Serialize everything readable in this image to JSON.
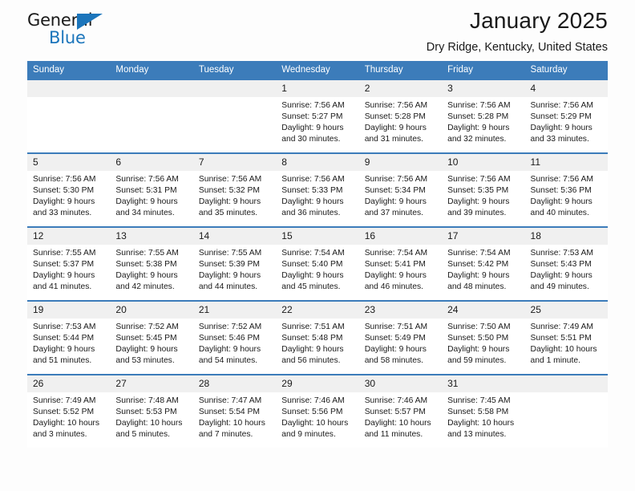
{
  "brand": {
    "name_top": "General",
    "name_bottom": "Blue",
    "flag_icon": "triangle-flag-icon",
    "accent_color": "#1b75bb"
  },
  "header": {
    "title": "January 2025",
    "location": "Dry Ridge, Kentucky, United States"
  },
  "calendar": {
    "header_bg": "#3c7cba",
    "daynum_bg": "#f0f0f0",
    "weekdays": [
      "Sunday",
      "Monday",
      "Tuesday",
      "Wednesday",
      "Thursday",
      "Friday",
      "Saturday"
    ],
    "weeks": [
      [
        {
          "day": "",
          "empty": true,
          "lines": []
        },
        {
          "day": "",
          "empty": true,
          "lines": []
        },
        {
          "day": "",
          "empty": true,
          "lines": []
        },
        {
          "day": "1",
          "lines": [
            "Sunrise: 7:56 AM",
            "Sunset: 5:27 PM",
            "Daylight: 9 hours",
            "and 30 minutes."
          ]
        },
        {
          "day": "2",
          "lines": [
            "Sunrise: 7:56 AM",
            "Sunset: 5:28 PM",
            "Daylight: 9 hours",
            "and 31 minutes."
          ]
        },
        {
          "day": "3",
          "lines": [
            "Sunrise: 7:56 AM",
            "Sunset: 5:28 PM",
            "Daylight: 9 hours",
            "and 32 minutes."
          ]
        },
        {
          "day": "4",
          "lines": [
            "Sunrise: 7:56 AM",
            "Sunset: 5:29 PM",
            "Daylight: 9 hours",
            "and 33 minutes."
          ]
        }
      ],
      [
        {
          "day": "5",
          "lines": [
            "Sunrise: 7:56 AM",
            "Sunset: 5:30 PM",
            "Daylight: 9 hours",
            "and 33 minutes."
          ]
        },
        {
          "day": "6",
          "lines": [
            "Sunrise: 7:56 AM",
            "Sunset: 5:31 PM",
            "Daylight: 9 hours",
            "and 34 minutes."
          ]
        },
        {
          "day": "7",
          "lines": [
            "Sunrise: 7:56 AM",
            "Sunset: 5:32 PM",
            "Daylight: 9 hours",
            "and 35 minutes."
          ]
        },
        {
          "day": "8",
          "lines": [
            "Sunrise: 7:56 AM",
            "Sunset: 5:33 PM",
            "Daylight: 9 hours",
            "and 36 minutes."
          ]
        },
        {
          "day": "9",
          "lines": [
            "Sunrise: 7:56 AM",
            "Sunset: 5:34 PM",
            "Daylight: 9 hours",
            "and 37 minutes."
          ]
        },
        {
          "day": "10",
          "lines": [
            "Sunrise: 7:56 AM",
            "Sunset: 5:35 PM",
            "Daylight: 9 hours",
            "and 39 minutes."
          ]
        },
        {
          "day": "11",
          "lines": [
            "Sunrise: 7:56 AM",
            "Sunset: 5:36 PM",
            "Daylight: 9 hours",
            "and 40 minutes."
          ]
        }
      ],
      [
        {
          "day": "12",
          "lines": [
            "Sunrise: 7:55 AM",
            "Sunset: 5:37 PM",
            "Daylight: 9 hours",
            "and 41 minutes."
          ]
        },
        {
          "day": "13",
          "lines": [
            "Sunrise: 7:55 AM",
            "Sunset: 5:38 PM",
            "Daylight: 9 hours",
            "and 42 minutes."
          ]
        },
        {
          "day": "14",
          "lines": [
            "Sunrise: 7:55 AM",
            "Sunset: 5:39 PM",
            "Daylight: 9 hours",
            "and 44 minutes."
          ]
        },
        {
          "day": "15",
          "lines": [
            "Sunrise: 7:54 AM",
            "Sunset: 5:40 PM",
            "Daylight: 9 hours",
            "and 45 minutes."
          ]
        },
        {
          "day": "16",
          "lines": [
            "Sunrise: 7:54 AM",
            "Sunset: 5:41 PM",
            "Daylight: 9 hours",
            "and 46 minutes."
          ]
        },
        {
          "day": "17",
          "lines": [
            "Sunrise: 7:54 AM",
            "Sunset: 5:42 PM",
            "Daylight: 9 hours",
            "and 48 minutes."
          ]
        },
        {
          "day": "18",
          "lines": [
            "Sunrise: 7:53 AM",
            "Sunset: 5:43 PM",
            "Daylight: 9 hours",
            "and 49 minutes."
          ]
        }
      ],
      [
        {
          "day": "19",
          "lines": [
            "Sunrise: 7:53 AM",
            "Sunset: 5:44 PM",
            "Daylight: 9 hours",
            "and 51 minutes."
          ]
        },
        {
          "day": "20",
          "lines": [
            "Sunrise: 7:52 AM",
            "Sunset: 5:45 PM",
            "Daylight: 9 hours",
            "and 53 minutes."
          ]
        },
        {
          "day": "21",
          "lines": [
            "Sunrise: 7:52 AM",
            "Sunset: 5:46 PM",
            "Daylight: 9 hours",
            "and 54 minutes."
          ]
        },
        {
          "day": "22",
          "lines": [
            "Sunrise: 7:51 AM",
            "Sunset: 5:48 PM",
            "Daylight: 9 hours",
            "and 56 minutes."
          ]
        },
        {
          "day": "23",
          "lines": [
            "Sunrise: 7:51 AM",
            "Sunset: 5:49 PM",
            "Daylight: 9 hours",
            "and 58 minutes."
          ]
        },
        {
          "day": "24",
          "lines": [
            "Sunrise: 7:50 AM",
            "Sunset: 5:50 PM",
            "Daylight: 9 hours",
            "and 59 minutes."
          ]
        },
        {
          "day": "25",
          "lines": [
            "Sunrise: 7:49 AM",
            "Sunset: 5:51 PM",
            "Daylight: 10 hours",
            "and 1 minute."
          ]
        }
      ],
      [
        {
          "day": "26",
          "lines": [
            "Sunrise: 7:49 AM",
            "Sunset: 5:52 PM",
            "Daylight: 10 hours",
            "and 3 minutes."
          ]
        },
        {
          "day": "27",
          "lines": [
            "Sunrise: 7:48 AM",
            "Sunset: 5:53 PM",
            "Daylight: 10 hours",
            "and 5 minutes."
          ]
        },
        {
          "day": "28",
          "lines": [
            "Sunrise: 7:47 AM",
            "Sunset: 5:54 PM",
            "Daylight: 10 hours",
            "and 7 minutes."
          ]
        },
        {
          "day": "29",
          "lines": [
            "Sunrise: 7:46 AM",
            "Sunset: 5:56 PM",
            "Daylight: 10 hours",
            "and 9 minutes."
          ]
        },
        {
          "day": "30",
          "lines": [
            "Sunrise: 7:46 AM",
            "Sunset: 5:57 PM",
            "Daylight: 10 hours",
            "and 11 minutes."
          ]
        },
        {
          "day": "31",
          "lines": [
            "Sunrise: 7:45 AM",
            "Sunset: 5:58 PM",
            "Daylight: 10 hours",
            "and 13 minutes."
          ]
        },
        {
          "day": "",
          "empty": true,
          "lines": []
        }
      ]
    ]
  }
}
